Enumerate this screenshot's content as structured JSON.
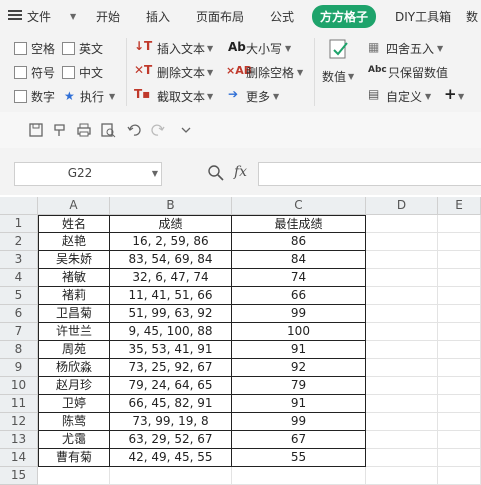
{
  "menu": {
    "file": "文件",
    "items": [
      "开始",
      "插入",
      "页面布局",
      "公式",
      "方方格子",
      "DIY工具箱",
      "数"
    ]
  },
  "ribbon": {
    "checks": [
      "空格",
      "英文",
      "符号",
      "中文",
      "数字"
    ],
    "exec": "执行",
    "insert_text": "插入文本",
    "delete_text": "删除文本",
    "cut_text": "截取文本",
    "case": "大小写",
    "delete_space": "删除空格",
    "more": "更多",
    "value": "数值",
    "round": "四舍五入",
    "keep_value": "只保留数值",
    "custom": "自定义"
  },
  "formula_bar": {
    "cell_ref": "G22",
    "fx": "fx"
  },
  "sheet": {
    "columns": [
      "A",
      "B",
      "C",
      "D",
      "E"
    ],
    "rows": [
      [
        "姓名",
        "成绩",
        "最佳成绩"
      ],
      [
        "赵艳",
        "16, 2, 59, 86",
        "86"
      ],
      [
        "吴朱娇",
        "83, 54, 69, 84",
        "84"
      ],
      [
        "褚敏",
        "32, 6, 47, 74",
        "74"
      ],
      [
        "褚莉",
        "11, 41, 51, 66",
        "66"
      ],
      [
        "卫昌菊",
        "51, 99, 63, 92",
        "99"
      ],
      [
        "许世兰",
        "9, 45, 100, 88",
        "100"
      ],
      [
        "周苑",
        "35, 53, 41, 91",
        "91"
      ],
      [
        "杨欣淼",
        "73, 25, 92, 67",
        "92"
      ],
      [
        "赵月珍",
        "79, 24, 64, 65",
        "79"
      ],
      [
        "卫婷",
        "66, 45, 82, 91",
        "91"
      ],
      [
        "陈莺",
        "73, 99, 19, 8",
        "99"
      ],
      [
        "尤霭",
        "63, 29, 52, 67",
        "67"
      ],
      [
        "曹有菊",
        "42, 49, 45, 55",
        "55"
      ],
      [
        "",
        "",
        ""
      ]
    ],
    "row_numbers": [
      "1",
      "2",
      "3",
      "4",
      "5",
      "6",
      "7",
      "8",
      "9",
      "10",
      "11",
      "12",
      "13",
      "14",
      "15"
    ]
  }
}
